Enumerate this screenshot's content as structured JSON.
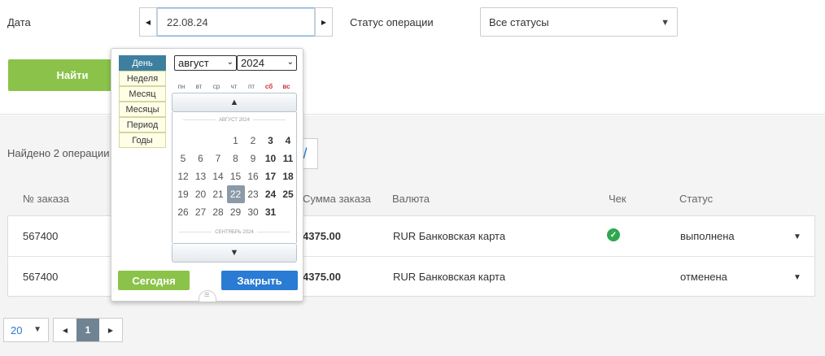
{
  "filters": {
    "date_label": "Дата",
    "date_value": "22.08.24",
    "status_label": "Статус операции",
    "status_value": "Все статусы",
    "find_label": "Найти"
  },
  "results": {
    "found_text": "Найдено 2 операции",
    "columns": [
      "№ заказа",
      "Сумма заказа",
      "Валюта",
      "Чек",
      "Статус"
    ],
    "rows": [
      {
        "order": "567400",
        "amount": "4375.00",
        "currency": "RUR Банковская карта",
        "check": true,
        "status": "выполнена"
      },
      {
        "order": "567400",
        "amount": "4375.00",
        "currency": "RUR Банковская карта",
        "check": false,
        "status": "отменена"
      }
    ]
  },
  "pager": {
    "per_page": "20",
    "current_page": "1"
  },
  "calendar": {
    "modes": [
      "День",
      "Неделя",
      "Месяц",
      "Месяцы",
      "Период",
      "Годы"
    ],
    "active_mode": "День",
    "month_select": "август",
    "year_select": "2024",
    "weekdays": [
      "пн",
      "вт",
      "ср",
      "чт",
      "пт",
      "сб",
      "вс"
    ],
    "month_label": "АВГУСТ 2024",
    "next_month_label": "СЕНТЯБРЬ 2024",
    "weeks": [
      [
        "",
        "",
        "",
        "1",
        "2",
        "3",
        "4"
      ],
      [
        "5",
        "6",
        "7",
        "8",
        "9",
        "10",
        "11"
      ],
      [
        "12",
        "13",
        "14",
        "15",
        "16",
        "17",
        "18"
      ],
      [
        "19",
        "20",
        "21",
        "22",
        "23",
        "24",
        "25"
      ],
      [
        "26",
        "27",
        "28",
        "29",
        "30",
        "31",
        ""
      ]
    ],
    "selected_day": "22",
    "today_label": "Сегодня",
    "close_label": "Закрыть"
  },
  "colors": {
    "green": "#8bc34a",
    "blue": "#2a7bd4",
    "check_green": "#2ea84f",
    "active_mode": "#3e7fa0"
  }
}
